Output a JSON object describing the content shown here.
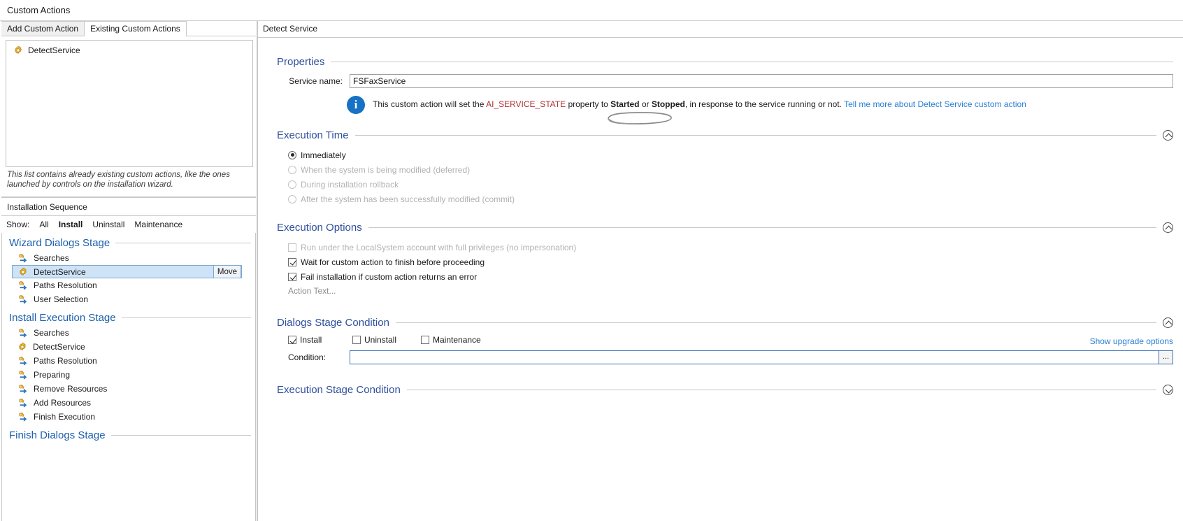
{
  "window": {
    "title": "Custom Actions"
  },
  "left": {
    "tabs": [
      {
        "label": "Add Custom Action",
        "active": false
      },
      {
        "label": "Existing Custom Actions",
        "active": true
      }
    ],
    "existing_actions": [
      {
        "label": "DetectService",
        "icon": "gear-icon"
      }
    ],
    "hint": "This list contains already existing custom actions, like the ones launched by controls on the installation wizard.",
    "sequence_header": "Installation Sequence",
    "show_label": "Show:",
    "show_options": [
      {
        "label": "All",
        "selected": false
      },
      {
        "label": "Install",
        "selected": true
      },
      {
        "label": "Uninstall",
        "selected": false
      },
      {
        "label": "Maintenance",
        "selected": false
      }
    ],
    "stages": [
      {
        "title": "Wizard Dialogs Stage",
        "items": [
          {
            "label": "Searches",
            "icon": "action-arrow-icon",
            "selected": false
          },
          {
            "label": "DetectService",
            "icon": "gear-icon",
            "selected": true,
            "move_label": "Move"
          },
          {
            "label": "Paths Resolution",
            "icon": "action-arrow-icon",
            "selected": false
          },
          {
            "label": "User Selection",
            "icon": "action-arrow-icon",
            "selected": false
          }
        ]
      },
      {
        "title": "Install Execution Stage",
        "items": [
          {
            "label": "Searches",
            "icon": "action-arrow-icon",
            "selected": false
          },
          {
            "label": "DetectService",
            "icon": "gear-icon",
            "selected": false
          },
          {
            "label": "Paths Resolution",
            "icon": "action-arrow-icon",
            "selected": false
          },
          {
            "label": "Preparing",
            "icon": "action-arrow-icon",
            "selected": false
          },
          {
            "label": "Remove Resources",
            "icon": "action-arrow-icon",
            "selected": false
          },
          {
            "label": "Add Resources",
            "icon": "action-arrow-icon",
            "selected": false
          },
          {
            "label": "Finish Execution",
            "icon": "action-arrow-icon",
            "selected": false
          }
        ]
      },
      {
        "title": "Finish Dialogs Stage",
        "items": []
      }
    ]
  },
  "right": {
    "header": "Detect Service",
    "properties": {
      "title": "Properties",
      "service_name_label": "Service name:",
      "service_name_value": "FSFaxService",
      "service_name_placeholder": "",
      "annotation": "hand-drawn-ellipse"
    },
    "info": {
      "icon": "info-icon",
      "text_part1": "This custom action will set the ",
      "property": "AI_SERVICE_STATE",
      "text_part2": " property to ",
      "state_started": "Started",
      "text_or": " or ",
      "state_stopped": "Stopped",
      "text_part3": ", in response to the service running or not. ",
      "link": "Tell me more about Detect Service custom action"
    },
    "execution_time": {
      "title": "Execution Time",
      "collapse_icon": "chevron-up-icon",
      "options": [
        {
          "label": "Immediately",
          "selected": true,
          "disabled": false
        },
        {
          "label": "When the system is being modified (deferred)",
          "selected": false,
          "disabled": true
        },
        {
          "label": "During installation rollback",
          "selected": false,
          "disabled": true
        },
        {
          "label": "After the system has been successfully modified (commit)",
          "selected": false,
          "disabled": true
        }
      ]
    },
    "execution_options": {
      "title": "Execution Options",
      "collapse_icon": "chevron-up-icon",
      "options": [
        {
          "label": "Run under the LocalSystem account with full privileges (no impersonation)",
          "checked": false,
          "disabled": true
        },
        {
          "label": "Wait for custom action to finish before proceeding",
          "checked": true,
          "disabled": false
        },
        {
          "label": "Fail installation if custom action returns an error",
          "checked": true,
          "disabled": false
        }
      ],
      "action_text": "Action Text..."
    },
    "dialogs_stage_condition": {
      "title": "Dialogs Stage Condition",
      "collapse_icon": "chevron-up-icon",
      "checks": [
        {
          "label": "Install",
          "checked": true
        },
        {
          "label": "Uninstall",
          "checked": false
        },
        {
          "label": "Maintenance",
          "checked": false
        }
      ],
      "upgrade_link": "Show upgrade options",
      "condition_label": "Condition:",
      "condition_value": "",
      "condition_placeholder": "",
      "browse_label": "..."
    },
    "execution_stage_condition": {
      "title": "Execution Stage Condition",
      "collapse_icon": "chevron-down-icon"
    }
  },
  "colors": {
    "section_heading": "#2f4f9e",
    "stage_heading": "#1c5fad",
    "link": "#2a7fd4",
    "property_code": "#b03030",
    "selection": "#cfe3f7",
    "info_badge": "#1572c4"
  }
}
